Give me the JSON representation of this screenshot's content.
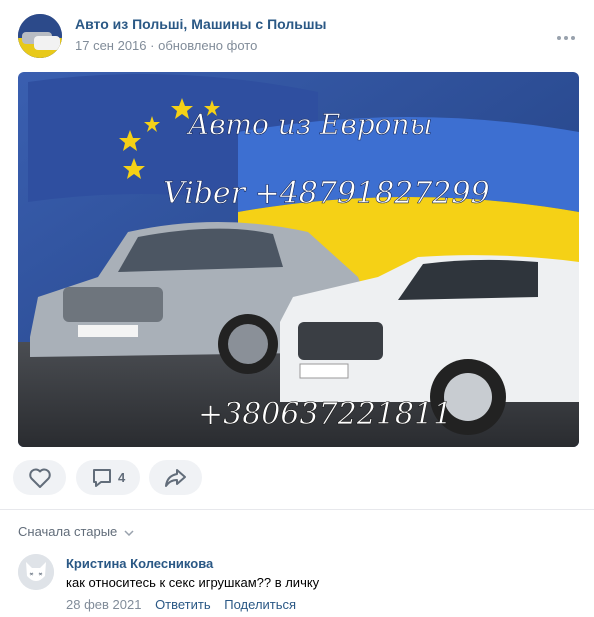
{
  "post": {
    "author": "Авто из Польші, Машины с Польшы",
    "date": "17 сен 2016",
    "separator": "·",
    "action": "обновлено фото",
    "more_icon": "more-dots-icon"
  },
  "photo": {
    "headline": "Авто из Европы",
    "viber": "Viber +48791827299",
    "phone": "+380637221811",
    "colors": {
      "sky": "#2f56a8",
      "yellow": "#f5d116",
      "blue": "#3d6fd1"
    }
  },
  "actions": {
    "like_icon": "heart-icon",
    "comment_icon": "comment-icon",
    "comment_count": "4",
    "share_icon": "share-icon"
  },
  "comments": {
    "sort_label": "Сначала старые",
    "items": [
      {
        "author": "Кристина Колесникова",
        "text": "как относитесь к секс игрушкам?? в личку",
        "date": "28 фев 2021",
        "reply": "Ответить",
        "share": "Поделиться"
      }
    ]
  }
}
